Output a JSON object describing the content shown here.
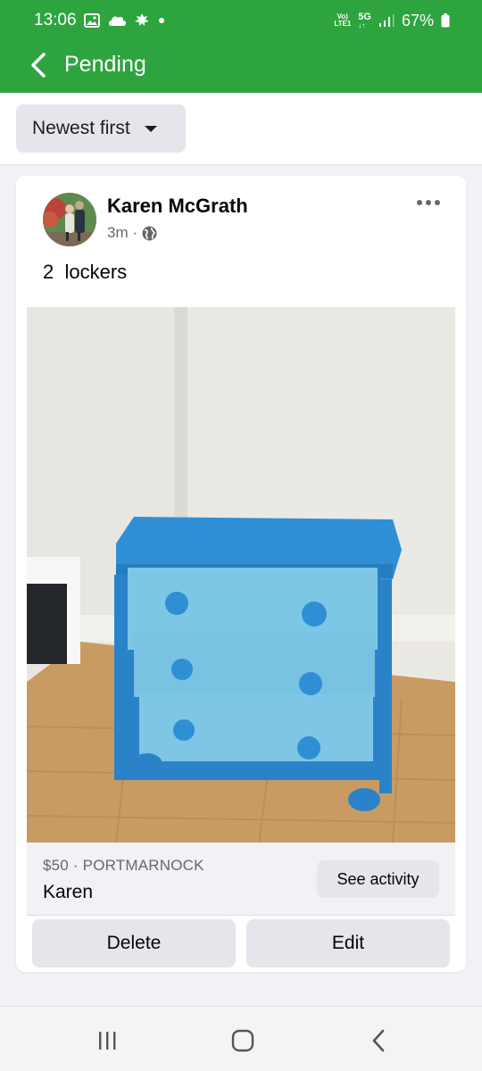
{
  "status_bar": {
    "time": "13:06",
    "network_label_top": "Vo)",
    "network_label_bottom": "LTE1",
    "network_type": "5G",
    "battery": "67%"
  },
  "header": {
    "title": "Pending"
  },
  "sort": {
    "label": "Newest first"
  },
  "post": {
    "author": "Karen McGrath",
    "time_ago": "3m",
    "separator": "·",
    "text": "2  lockers",
    "listing": {
      "price_location": "$50 · PORTMARNOCK",
      "seller": "Karen",
      "see_activity_label": "See activity"
    },
    "actions": {
      "delete_label": "Delete",
      "edit_label": "Edit"
    }
  },
  "colors": {
    "accent_green": "#2ea43f",
    "button_gray": "#e4e6eb",
    "dresser_frame": "#2a83c9",
    "drawer_front": "#7cc7e6"
  }
}
